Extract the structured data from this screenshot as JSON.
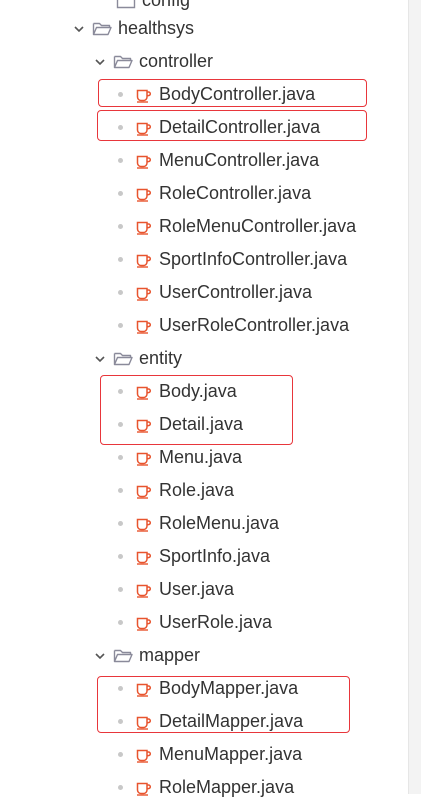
{
  "tree": {
    "config_label": "config",
    "healthsys_label": "healthsys",
    "controller": {
      "label": "controller",
      "files": [
        "BodyController.java",
        "DetailController.java",
        "MenuController.java",
        "RoleController.java",
        "RoleMenuController.java",
        "SportInfoController.java",
        "UserController.java",
        "UserRoleController.java"
      ]
    },
    "entity": {
      "label": "entity",
      "files": [
        "Body.java",
        "Detail.java",
        "Menu.java",
        "Role.java",
        "RoleMenu.java",
        "SportInfo.java",
        "User.java",
        "UserRole.java"
      ]
    },
    "mapper": {
      "label": "mapper",
      "files": [
        "BodyMapper.java",
        "DetailMapper.java",
        "MenuMapper.java",
        "RoleMapper.java"
      ]
    }
  },
  "colors": {
    "java_icon": "#e8542e",
    "highlight_box": "#e8363b",
    "folder_icon": "#8a8a9a",
    "chevron": "#555555"
  },
  "icons": {
    "expanded": "chevron-down-icon",
    "folder": "folder-open-icon",
    "java_file": "java-coffee-cup-icon"
  }
}
